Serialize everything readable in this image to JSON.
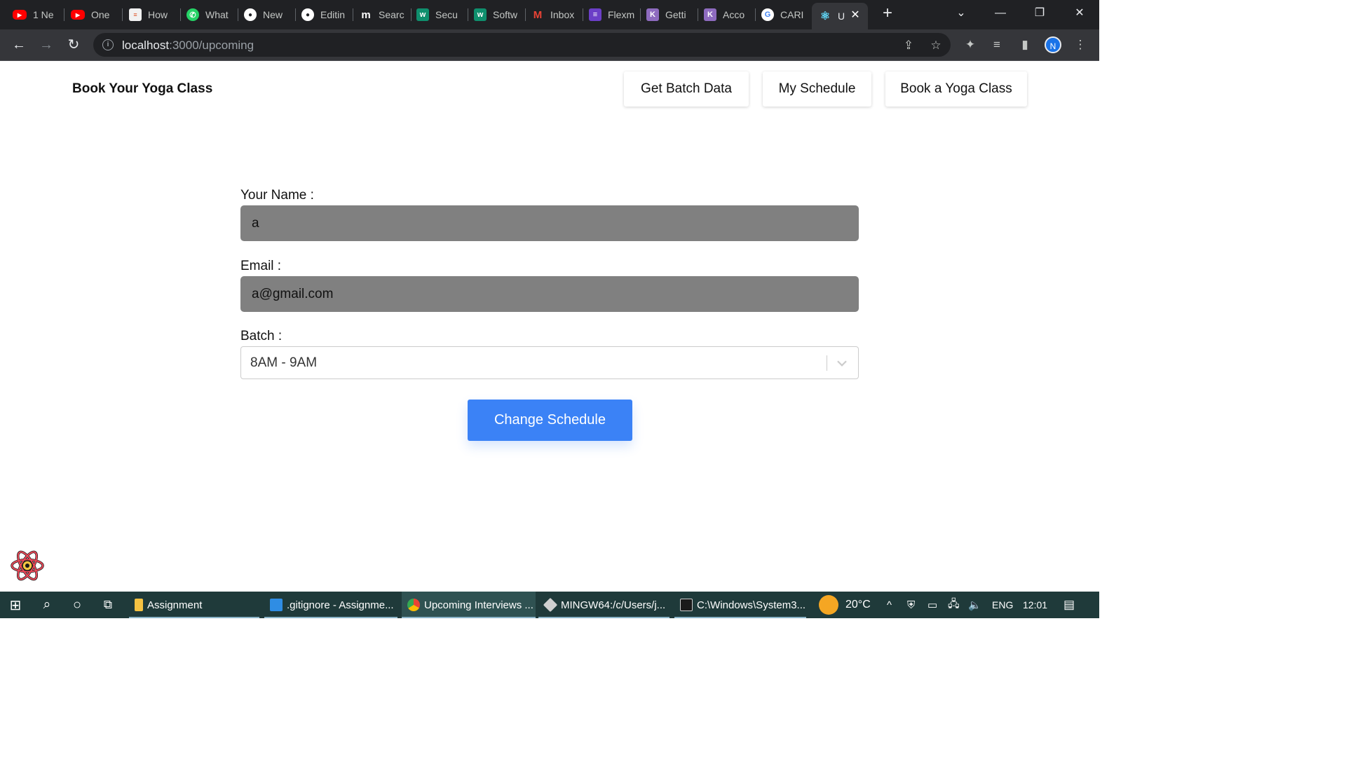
{
  "browser": {
    "tabs": [
      {
        "label": "1 Ne",
        "icon": "youtube-icon",
        "color": "#ff0000"
      },
      {
        "label": "One",
        "icon": "youtube-icon",
        "color": "#ff0000"
      },
      {
        "label": "How",
        "icon": "page-icon",
        "color": "#f1f1f1"
      },
      {
        "label": "What",
        "icon": "whatsapp-icon",
        "color": "#25d366"
      },
      {
        "label": "New",
        "icon": "github-icon",
        "color": "#ffffff"
      },
      {
        "label": "Editin",
        "icon": "github-icon",
        "color": "#ffffff"
      },
      {
        "label": "Searc",
        "icon": "medium-icon",
        "color": "#ffffff"
      },
      {
        "label": "Secu",
        "icon": "workat-icon",
        "color": "#0f8f6d"
      },
      {
        "label": "Softw",
        "icon": "workat-icon",
        "color": "#0f8f6d"
      },
      {
        "label": "Inbox",
        "icon": "gmail-icon",
        "color": "#ea4335"
      },
      {
        "label": "Flexm",
        "icon": "flexmoney-icon",
        "color": "#6b3fc7"
      },
      {
        "label": "Getti",
        "icon": "kotlin-icon",
        "color": "#8e6bbf"
      },
      {
        "label": "Acco",
        "icon": "kotlin-icon",
        "color": "#8e6bbf"
      },
      {
        "label": "CARI",
        "icon": "google-icon",
        "color": "#ffffff"
      },
      {
        "label": "U",
        "icon": "react-icon",
        "color": "#61dafb"
      }
    ],
    "url_host": "localhost",
    "url_path": ":3000/upcoming",
    "profile_initial": "N"
  },
  "navbar": {
    "brand": "Book Your Yoga Class",
    "links": [
      "Get Batch Data",
      "My Schedule",
      "Book a Yoga Class"
    ]
  },
  "form": {
    "name_label": "Your Name :",
    "name_value": "a",
    "email_label": "Email :",
    "email_value": "a@gmail.com",
    "batch_label": "Batch :",
    "batch_value": "8AM - 9AM",
    "submit_label": "Change Schedule"
  },
  "taskbar": {
    "apps": [
      {
        "label": "Assignment",
        "icon": "folder-icon",
        "color": "#f5c242"
      },
      {
        "label": ".gitignore - Assignme...",
        "icon": "vscode-icon",
        "color": "#2f8de4"
      },
      {
        "label": "Upcoming Interviews ...",
        "icon": "chrome-icon",
        "color": "#ea4335"
      },
      {
        "label": "MINGW64:/c/Users/j...",
        "icon": "git-icon",
        "color": "#d0d0d0"
      },
      {
        "label": "C:\\Windows\\System3...",
        "icon": "cmd-icon",
        "color": "#cccccc"
      }
    ],
    "weather": "20°C",
    "language": "ENG",
    "time": "12:01"
  },
  "colors": {
    "accent": "#3b82f6",
    "input_bg": "#808080",
    "chrome_dark": "#202124",
    "taskbar": "#1f3a3a"
  }
}
